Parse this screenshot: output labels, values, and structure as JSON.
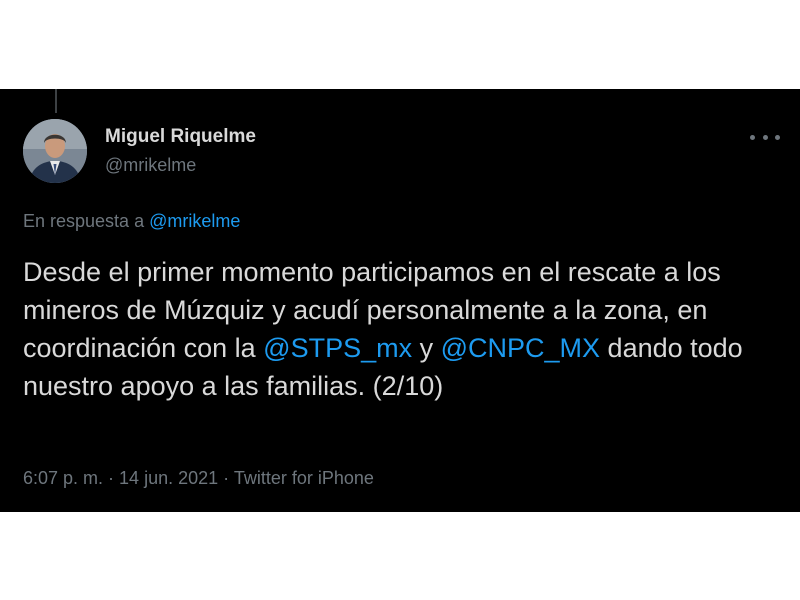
{
  "author": {
    "name": "Miguel Riquelme",
    "handle": "@mrikelme",
    "avatar_icon": "profile-photo"
  },
  "reply": {
    "prefix": "En respuesta a",
    "mention": "@mrikelme"
  },
  "tweet": {
    "text_1": "Desde el primer momento participamos en el rescate a los mineros de Múzquiz y acudí personalmente a la zona, en coordinación con la ",
    "mention_1": "@STPS_mx",
    "text_2": " y ",
    "mention_2": "@CNPC_MX",
    "text_3": " dando todo nuestro apoyo a las familias. (2/10)"
  },
  "meta": {
    "time": "6:07 p. m.",
    "separator_1": " · ",
    "date": "14 jun. 2021",
    "separator_2": " · ",
    "source": "Twitter for iPhone"
  },
  "colors": {
    "background": "#000000",
    "text": "#d9d9d9",
    "secondary": "#6e767d",
    "link": "#1d9bf0"
  }
}
